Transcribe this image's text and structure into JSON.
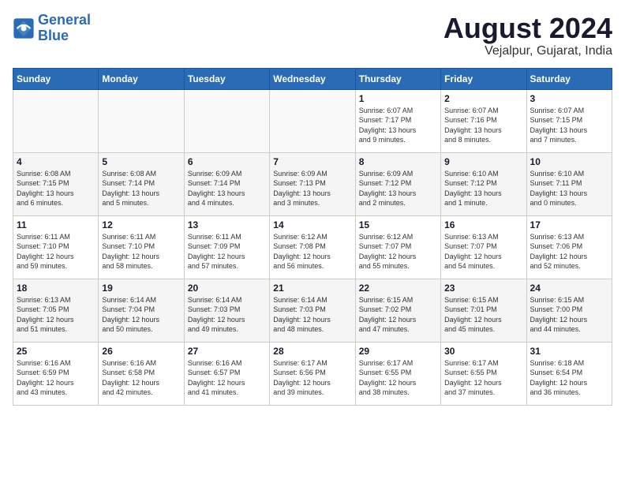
{
  "header": {
    "logo_line1": "General",
    "logo_line2": "Blue",
    "month_year": "August 2024",
    "location": "Vejalpur, Gujarat, India"
  },
  "weekdays": [
    "Sunday",
    "Monday",
    "Tuesday",
    "Wednesday",
    "Thursday",
    "Friday",
    "Saturday"
  ],
  "weeks": [
    [
      {
        "day": "",
        "detail": ""
      },
      {
        "day": "",
        "detail": ""
      },
      {
        "day": "",
        "detail": ""
      },
      {
        "day": "",
        "detail": ""
      },
      {
        "day": "1",
        "detail": "Sunrise: 6:07 AM\nSunset: 7:17 PM\nDaylight: 13 hours\nand 9 minutes."
      },
      {
        "day": "2",
        "detail": "Sunrise: 6:07 AM\nSunset: 7:16 PM\nDaylight: 13 hours\nand 8 minutes."
      },
      {
        "day": "3",
        "detail": "Sunrise: 6:07 AM\nSunset: 7:15 PM\nDaylight: 13 hours\nand 7 minutes."
      }
    ],
    [
      {
        "day": "4",
        "detail": "Sunrise: 6:08 AM\nSunset: 7:15 PM\nDaylight: 13 hours\nand 6 minutes."
      },
      {
        "day": "5",
        "detail": "Sunrise: 6:08 AM\nSunset: 7:14 PM\nDaylight: 13 hours\nand 5 minutes."
      },
      {
        "day": "6",
        "detail": "Sunrise: 6:09 AM\nSunset: 7:14 PM\nDaylight: 13 hours\nand 4 minutes."
      },
      {
        "day": "7",
        "detail": "Sunrise: 6:09 AM\nSunset: 7:13 PM\nDaylight: 13 hours\nand 3 minutes."
      },
      {
        "day": "8",
        "detail": "Sunrise: 6:09 AM\nSunset: 7:12 PM\nDaylight: 13 hours\nand 2 minutes."
      },
      {
        "day": "9",
        "detail": "Sunrise: 6:10 AM\nSunset: 7:12 PM\nDaylight: 13 hours\nand 1 minute."
      },
      {
        "day": "10",
        "detail": "Sunrise: 6:10 AM\nSunset: 7:11 PM\nDaylight: 13 hours\nand 0 minutes."
      }
    ],
    [
      {
        "day": "11",
        "detail": "Sunrise: 6:11 AM\nSunset: 7:10 PM\nDaylight: 12 hours\nand 59 minutes."
      },
      {
        "day": "12",
        "detail": "Sunrise: 6:11 AM\nSunset: 7:10 PM\nDaylight: 12 hours\nand 58 minutes."
      },
      {
        "day": "13",
        "detail": "Sunrise: 6:11 AM\nSunset: 7:09 PM\nDaylight: 12 hours\nand 57 minutes."
      },
      {
        "day": "14",
        "detail": "Sunrise: 6:12 AM\nSunset: 7:08 PM\nDaylight: 12 hours\nand 56 minutes."
      },
      {
        "day": "15",
        "detail": "Sunrise: 6:12 AM\nSunset: 7:07 PM\nDaylight: 12 hours\nand 55 minutes."
      },
      {
        "day": "16",
        "detail": "Sunrise: 6:13 AM\nSunset: 7:07 PM\nDaylight: 12 hours\nand 54 minutes."
      },
      {
        "day": "17",
        "detail": "Sunrise: 6:13 AM\nSunset: 7:06 PM\nDaylight: 12 hours\nand 52 minutes."
      }
    ],
    [
      {
        "day": "18",
        "detail": "Sunrise: 6:13 AM\nSunset: 7:05 PM\nDaylight: 12 hours\nand 51 minutes."
      },
      {
        "day": "19",
        "detail": "Sunrise: 6:14 AM\nSunset: 7:04 PM\nDaylight: 12 hours\nand 50 minutes."
      },
      {
        "day": "20",
        "detail": "Sunrise: 6:14 AM\nSunset: 7:03 PM\nDaylight: 12 hours\nand 49 minutes."
      },
      {
        "day": "21",
        "detail": "Sunrise: 6:14 AM\nSunset: 7:03 PM\nDaylight: 12 hours\nand 48 minutes."
      },
      {
        "day": "22",
        "detail": "Sunrise: 6:15 AM\nSunset: 7:02 PM\nDaylight: 12 hours\nand 47 minutes."
      },
      {
        "day": "23",
        "detail": "Sunrise: 6:15 AM\nSunset: 7:01 PM\nDaylight: 12 hours\nand 45 minutes."
      },
      {
        "day": "24",
        "detail": "Sunrise: 6:15 AM\nSunset: 7:00 PM\nDaylight: 12 hours\nand 44 minutes."
      }
    ],
    [
      {
        "day": "25",
        "detail": "Sunrise: 6:16 AM\nSunset: 6:59 PM\nDaylight: 12 hours\nand 43 minutes."
      },
      {
        "day": "26",
        "detail": "Sunrise: 6:16 AM\nSunset: 6:58 PM\nDaylight: 12 hours\nand 42 minutes."
      },
      {
        "day": "27",
        "detail": "Sunrise: 6:16 AM\nSunset: 6:57 PM\nDaylight: 12 hours\nand 41 minutes."
      },
      {
        "day": "28",
        "detail": "Sunrise: 6:17 AM\nSunset: 6:56 PM\nDaylight: 12 hours\nand 39 minutes."
      },
      {
        "day": "29",
        "detail": "Sunrise: 6:17 AM\nSunset: 6:55 PM\nDaylight: 12 hours\nand 38 minutes."
      },
      {
        "day": "30",
        "detail": "Sunrise: 6:17 AM\nSunset: 6:55 PM\nDaylight: 12 hours\nand 37 minutes."
      },
      {
        "day": "31",
        "detail": "Sunrise: 6:18 AM\nSunset: 6:54 PM\nDaylight: 12 hours\nand 36 minutes."
      }
    ]
  ]
}
